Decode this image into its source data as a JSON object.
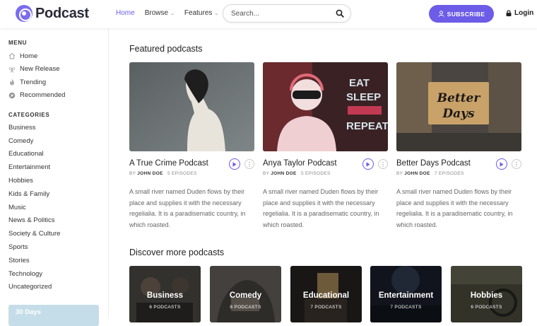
{
  "brand": {
    "name": "Podcast"
  },
  "nav": [
    {
      "label": "Home",
      "active": true
    },
    {
      "label": "Browse",
      "dropdown": true
    },
    {
      "label": "Features",
      "dropdown": true
    }
  ],
  "search": {
    "placeholder": "Search...",
    "value": ""
  },
  "header": {
    "subscribe_label": "SUBSCRIBE",
    "login_label": "Login"
  },
  "sidebar": {
    "menu_heading": "MENU",
    "menu": [
      {
        "label": "Home",
        "icon": "home-icon"
      },
      {
        "label": "New Release",
        "icon": "broadcast-icon"
      },
      {
        "label": "Trending",
        "icon": "fire-icon"
      },
      {
        "label": "Recommended",
        "icon": "compass-icon"
      }
    ],
    "categories_heading": "CATEGORIES",
    "categories": [
      "Business",
      "Comedy",
      "Educational",
      "Entertainment",
      "Hobbies",
      "Kids & Family",
      "Music",
      "News & Politics",
      "Society & Culture",
      "Sports",
      "Stories",
      "Technology",
      "Uncategorized"
    ],
    "promo_text": "30 Days"
  },
  "featured": {
    "title": "Featured podcasts",
    "items": [
      {
        "title": "A True Crime Podcast",
        "by": "BY",
        "author": "JOHN DOE",
        "episodes": "5 EPISODES",
        "description": "A small river named Duden flows by their place and supplies it with the necessary regelialia. It is a paradisematic country, in which roasted."
      },
      {
        "title": "Anya Taylor Podcast",
        "by": "BY",
        "author": "JOHN DOE",
        "episodes": "5 EPISODES",
        "description": "A small river named Duden flows by their place and supplies it with the necessary regelialia. It is a paradisematic country, in which roasted.",
        "sign_text": [
          "EAT",
          "SLEEP",
          "REPEAT"
        ]
      },
      {
        "title": "Better Days Podcast",
        "by": "BY",
        "author": "JOHN DOE",
        "episodes": "7 EPISODES",
        "description": "A small river named Duden flows by their place and supplies it with the necessary regelialia. It is a paradisematic country, in which roasted.",
        "sign_text": [
          "Better",
          "Days"
        ]
      }
    ]
  },
  "discover": {
    "title": "Discover more podcasts",
    "items": [
      {
        "name": "Business",
        "count": "6 PODCASTS"
      },
      {
        "name": "Comedy",
        "count": "8 PODCASTS"
      },
      {
        "name": "Educational",
        "count": "7 PODCASTS"
      },
      {
        "name": "Entertainment",
        "count": "7 PODCASTS"
      },
      {
        "name": "Hobbies",
        "count": "6 PODCASTS"
      }
    ]
  },
  "colors": {
    "accent": "#6c5ce7",
    "text": "#222222",
    "muted": "#888888"
  }
}
